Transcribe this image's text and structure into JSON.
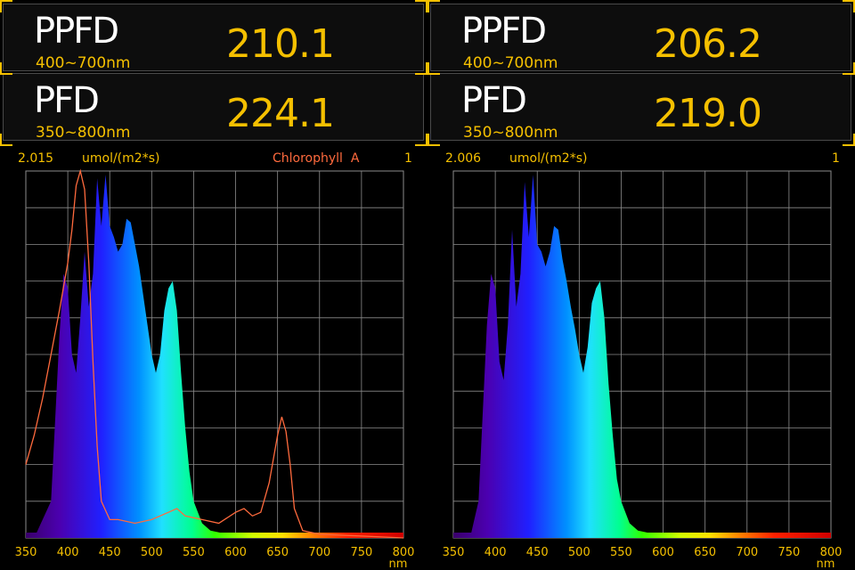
{
  "panels": [
    {
      "ppfd": {
        "label": "PPFD",
        "range": "400~700nm",
        "value": "210.1"
      },
      "pfd": {
        "label": "PFD",
        "range": "350~800nm",
        "value": "224.1"
      },
      "chart_header": {
        "max": "2.015",
        "unit": "umol/(m2*s)",
        "overlay": "Chlorophyll  A",
        "right": "1"
      }
    },
    {
      "ppfd": {
        "label": "PPFD",
        "range": "400~700nm",
        "value": "206.2"
      },
      "pfd": {
        "label": "PFD",
        "range": "350~800nm",
        "value": "219.0"
      },
      "chart_header": {
        "max": "2.006",
        "unit": "umol/(m2*s)",
        "overlay": "",
        "right": "1"
      }
    }
  ],
  "colors": {
    "accent": "#f5c000",
    "overlay": "#ff6a3d",
    "grid": "#8c8c8c"
  },
  "chart_data": [
    {
      "type": "area",
      "x_unit": "nm",
      "xlim": [
        350,
        800
      ],
      "ylim": [
        0,
        1
      ],
      "x_ticks": [
        "350",
        "400",
        "450",
        "500",
        "550",
        "600",
        "650",
        "700",
        "750",
        "800"
      ],
      "grid": true,
      "series": [
        {
          "x": [
            360,
            380,
            390,
            395,
            400,
            405,
            410,
            415,
            420,
            425,
            430,
            435,
            440,
            445,
            450,
            455,
            460,
            465,
            470,
            475,
            480,
            485,
            490,
            495,
            500,
            505,
            510,
            515,
            520,
            525,
            530,
            535,
            540,
            545,
            550,
            560,
            570,
            580,
            590,
            600,
            650,
            700,
            800
          ],
          "y": [
            0.0,
            0.1,
            0.55,
            0.72,
            0.68,
            0.5,
            0.45,
            0.6,
            0.78,
            0.63,
            0.72,
            0.98,
            0.85,
            0.99,
            0.85,
            0.82,
            0.78,
            0.8,
            0.87,
            0.86,
            0.8,
            0.74,
            0.66,
            0.58,
            0.5,
            0.45,
            0.5,
            0.62,
            0.68,
            0.7,
            0.62,
            0.45,
            0.3,
            0.18,
            0.1,
            0.04,
            0.02,
            0.015,
            0.01,
            0.008,
            0.006,
            0.004,
            0.002
          ]
        },
        {
          "name": "Chlorophyll  A",
          "x": [
            350,
            360,
            370,
            380,
            390,
            400,
            405,
            410,
            415,
            420,
            425,
            430,
            435,
            440,
            450,
            460,
            480,
            500,
            520,
            530,
            540,
            560,
            580,
            600,
            610,
            620,
            630,
            640,
            650,
            655,
            660,
            665,
            670,
            680,
            700,
            750,
            800
          ],
          "y": [
            0.2,
            0.28,
            0.38,
            0.5,
            0.62,
            0.75,
            0.84,
            0.96,
            1.0,
            0.95,
            0.75,
            0.48,
            0.25,
            0.1,
            0.05,
            0.05,
            0.04,
            0.05,
            0.07,
            0.08,
            0.06,
            0.05,
            0.04,
            0.07,
            0.08,
            0.06,
            0.07,
            0.15,
            0.28,
            0.33,
            0.29,
            0.2,
            0.08,
            0.02,
            0.01,
            0.005,
            0.0
          ]
        }
      ]
    },
    {
      "type": "area",
      "x_unit": "nm",
      "xlim": [
        350,
        800
      ],
      "ylim": [
        0,
        1
      ],
      "x_ticks": [
        "350",
        "400",
        "450",
        "500",
        "550",
        "600",
        "650",
        "700",
        "750",
        "800"
      ],
      "grid": true,
      "series": [
        {
          "x": [
            370,
            380,
            390,
            395,
            400,
            405,
            410,
            415,
            420,
            425,
            430,
            435,
            440,
            445,
            450,
            455,
            460,
            465,
            470,
            475,
            480,
            485,
            490,
            495,
            500,
            505,
            510,
            515,
            520,
            525,
            530,
            535,
            540,
            545,
            550,
            560,
            570,
            580,
            590,
            600,
            650,
            700,
            800
          ],
          "y": [
            0.0,
            0.1,
            0.58,
            0.72,
            0.68,
            0.48,
            0.43,
            0.58,
            0.84,
            0.63,
            0.72,
            0.97,
            0.82,
            0.99,
            0.8,
            0.78,
            0.74,
            0.78,
            0.85,
            0.84,
            0.76,
            0.7,
            0.63,
            0.57,
            0.5,
            0.45,
            0.52,
            0.64,
            0.68,
            0.7,
            0.6,
            0.42,
            0.28,
            0.16,
            0.1,
            0.04,
            0.02,
            0.015,
            0.01,
            0.008,
            0.006,
            0.004,
            0.002
          ]
        }
      ]
    }
  ]
}
